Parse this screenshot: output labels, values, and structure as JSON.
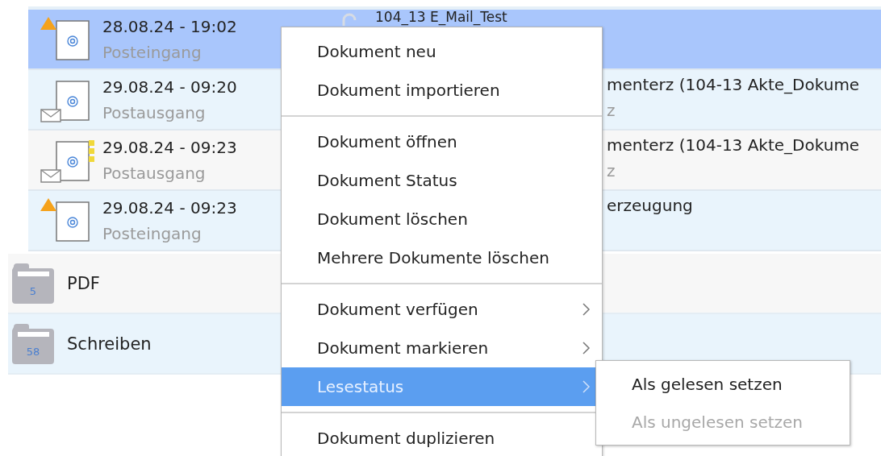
{
  "documents": [
    {
      "kind": "incoming",
      "selected": true,
      "marked": false,
      "date": "28.08.24 - 19:02",
      "folder": "Posteingang",
      "title": "104_13 E_Mail_Test"
    },
    {
      "kind": "outgoing",
      "selected": false,
      "marked": false,
      "date": "29.08.24 - 09:20",
      "folder": "Postausgang",
      "title": "menterz (104-13 Akte_Dokume",
      "subtitle": "z"
    },
    {
      "kind": "outgoing",
      "selected": false,
      "marked": true,
      "date": "29.08.24 - 09:23",
      "folder": "Postausgang",
      "title": "menterz (104-13 Akte_Dokume",
      "subtitle": "z"
    },
    {
      "kind": "incoming",
      "selected": false,
      "marked": false,
      "date": "29.08.24 - 09:23",
      "folder": "Posteingang",
      "title": "erzeugung"
    }
  ],
  "folders": [
    {
      "name": "PDF",
      "count": "5"
    },
    {
      "name": "Schreiben",
      "count": "58"
    }
  ],
  "context_menu": {
    "groups": [
      [
        {
          "label": "Dokument neu",
          "has_submenu": false,
          "selected": false
        },
        {
          "label": "Dokument importieren",
          "has_submenu": false,
          "selected": false
        }
      ],
      [
        {
          "label": "Dokument öffnen",
          "has_submenu": false,
          "selected": false
        },
        {
          "label": "Dokument Status",
          "has_submenu": false,
          "selected": false
        },
        {
          "label": "Dokument löschen",
          "has_submenu": false,
          "selected": false
        },
        {
          "label": "Mehrere Dokumente löschen",
          "has_submenu": false,
          "selected": false
        }
      ],
      [
        {
          "label": "Dokument verfügen",
          "has_submenu": true,
          "selected": false
        },
        {
          "label": "Dokument markieren",
          "has_submenu": true,
          "selected": false
        },
        {
          "label": "Lesestatus",
          "has_submenu": true,
          "selected": true
        }
      ],
      [
        {
          "label": "Dokument duplizieren",
          "has_submenu": false,
          "selected": false
        }
      ]
    ]
  },
  "submenu": {
    "items": [
      {
        "label": "Als gelesen setzen",
        "disabled": false
      },
      {
        "label": "Als ungelesen setzen",
        "disabled": true
      }
    ]
  }
}
